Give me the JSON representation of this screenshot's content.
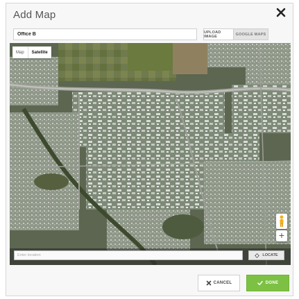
{
  "dialog": {
    "title": "Add Map",
    "close_icon": "close-icon"
  },
  "map_name": {
    "value": "Office B"
  },
  "source_tabs": [
    {
      "label": "UPLOAD IMAGE"
    },
    {
      "label": "GOOGLE MAPS"
    }
  ],
  "map": {
    "type_controls": [
      {
        "label": "Map"
      },
      {
        "label": "Satellite"
      }
    ],
    "zoom_in_label": "+",
    "locate": {
      "placeholder": "Enter location",
      "button_label": "LOCATE"
    }
  },
  "footer": {
    "cancel_label": "CANCEL",
    "done_label": "DONE"
  },
  "colors": {
    "done_button": "#7dc144",
    "close_icon": "#222222"
  }
}
